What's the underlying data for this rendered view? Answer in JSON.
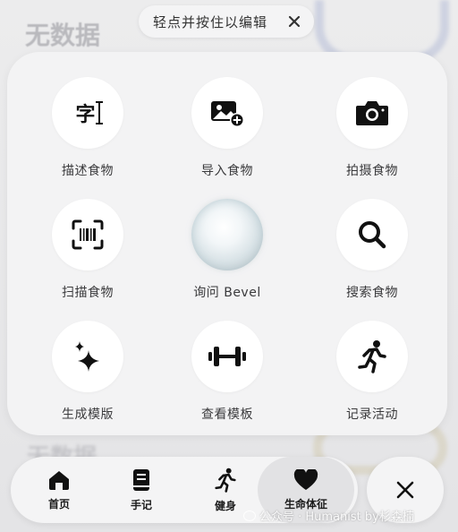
{
  "background": {
    "title": "无数据",
    "title_2": "无数据"
  },
  "hint": {
    "text": "轻点并按住以编辑"
  },
  "menu": {
    "items": [
      {
        "label": "描述食物",
        "icon": "text-cursor-icon",
        "glyph": "字"
      },
      {
        "label": "导入食物",
        "icon": "image-add-icon"
      },
      {
        "label": "拍摄食物",
        "icon": "camera-icon"
      },
      {
        "label": "扫描食物",
        "icon": "barcode-scan-icon"
      },
      {
        "label": "询问 Bevel",
        "icon": "bevel-orb-icon"
      },
      {
        "label": "搜索食物",
        "icon": "search-icon"
      },
      {
        "label": "生成模版",
        "icon": "sparkles-icon"
      },
      {
        "label": "查看模板",
        "icon": "dumbbell-icon"
      },
      {
        "label": "记录活动",
        "icon": "running-icon"
      }
    ]
  },
  "tabbar": {
    "tabs": [
      {
        "label": "首页",
        "icon": "home-icon"
      },
      {
        "label": "手记",
        "icon": "journal-icon"
      },
      {
        "label": "健身",
        "icon": "running-icon"
      },
      {
        "label": "生命体征",
        "icon": "heart-icon",
        "active": true
      }
    ]
  },
  "watermark": {
    "text": "公众号 · Humanist by杉森楠"
  },
  "colors": {
    "panel": "#f3f3f4",
    "icon": "#111111",
    "label": "#3a3a3c"
  }
}
